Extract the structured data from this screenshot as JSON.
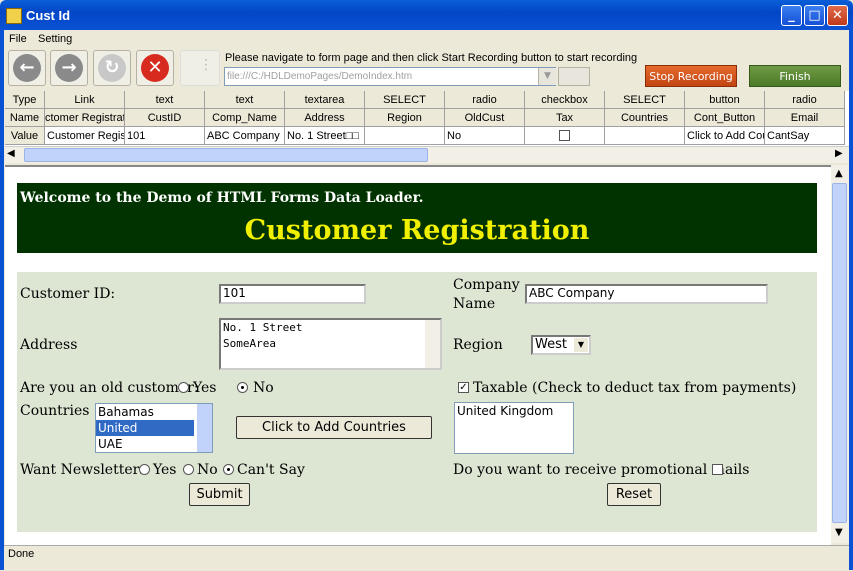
{
  "window": {
    "title": "Cust Id"
  },
  "menu": {
    "file": "File",
    "setting": "Setting"
  },
  "toolbar": {
    "instruction": "Please navigate to form page and then click Start Recording button to start recording",
    "url": "file:///C:/HDLDemoPages/DemoIndex.htm",
    "stop_label": "Stop Recording",
    "finish_label": "Finish",
    "colors": {
      "stop": "#d2561c",
      "finish": "#5c8a34"
    }
  },
  "grid": {
    "row_labels": [
      "Type",
      "Name",
      "Value"
    ],
    "columns": [
      {
        "type": "Link",
        "name": "ctomer Registrat",
        "value": "Customer Regis"
      },
      {
        "type": "text",
        "name": "CustID",
        "value": "101"
      },
      {
        "type": "text",
        "name": "Comp_Name",
        "value": "ABC Company"
      },
      {
        "type": "textarea",
        "name": "Address",
        "value": "No. 1 Street□□"
      },
      {
        "type": "SELECT",
        "name": "Region",
        "value": ""
      },
      {
        "type": "radio",
        "name": "OldCust",
        "value": "No"
      },
      {
        "type": "checkbox",
        "name": "Tax",
        "value": ""
      },
      {
        "type": "SELECT",
        "name": "Countries",
        "value": ""
      },
      {
        "type": "button",
        "name": "Cont_Button",
        "value": "Click to Add Cou"
      },
      {
        "type": "radio",
        "name": "Email",
        "value": "CantSay"
      }
    ]
  },
  "page": {
    "welcome": "Welcome to the Demo of HTML Forms Data Loader.",
    "title": "Customer Registration",
    "banner_color": "#003300",
    "title_color": "#f0f000",
    "form_bg": "#dde6d3",
    "customer_id_label": "Customer ID:",
    "customer_id_value": "101",
    "company_label_1": "Company",
    "company_label_2": "Name",
    "company_value": "ABC Company",
    "address_label": "Address",
    "address_line1": "No. 1 Street",
    "address_line2": "SomeArea",
    "region_label": "Region",
    "region_value": "West",
    "old_customer_label": "Are you an old customer:",
    "yes_label": "Yes",
    "no_label": "No",
    "taxable_label": "Taxable (Check to deduct tax from payments)",
    "countries_label": "Countries",
    "countries_options": [
      "Bahamas",
      "United Kingdom",
      "UAE"
    ],
    "countries_selected": "United Kingdom",
    "add_countries_label": "Click to Add Countries",
    "added_countries": [
      "United Kingdom"
    ],
    "newsletters_label": "Want Newsletters",
    "nl_yes": "Yes",
    "nl_no": "No",
    "nl_cantsay": "Can't Say",
    "promo_label": "Do you want to receive promotional mails",
    "submit_label": "Submit",
    "reset_label": "Reset"
  },
  "status": {
    "text": "Done"
  }
}
